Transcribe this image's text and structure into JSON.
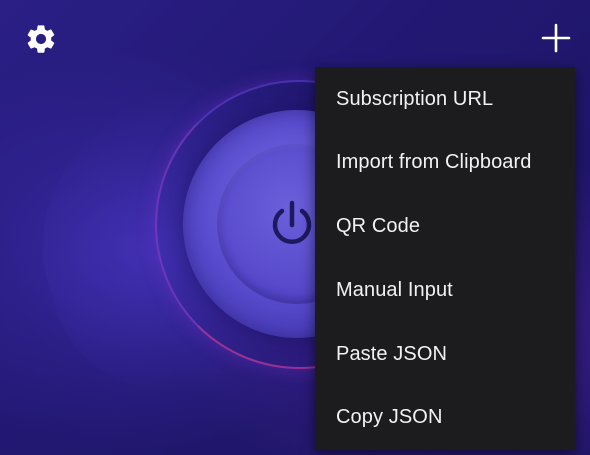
{
  "toolbar": {
    "settings_icon": "gear-icon",
    "add_icon": "plus-icon"
  },
  "connect": {
    "icon": "power-icon"
  },
  "add_menu": {
    "items": [
      {
        "label": "Subscription URL"
      },
      {
        "label": "Import from Clipboard"
      },
      {
        "label": "QR Code"
      },
      {
        "label": "Manual Input"
      },
      {
        "label": "Paste JSON"
      },
      {
        "label": "Copy JSON"
      }
    ]
  },
  "colors": {
    "background": "#241a73",
    "button": "#5a4dcf",
    "menu_bg": "#1c1c1e",
    "menu_text": "#f2f2f2"
  }
}
